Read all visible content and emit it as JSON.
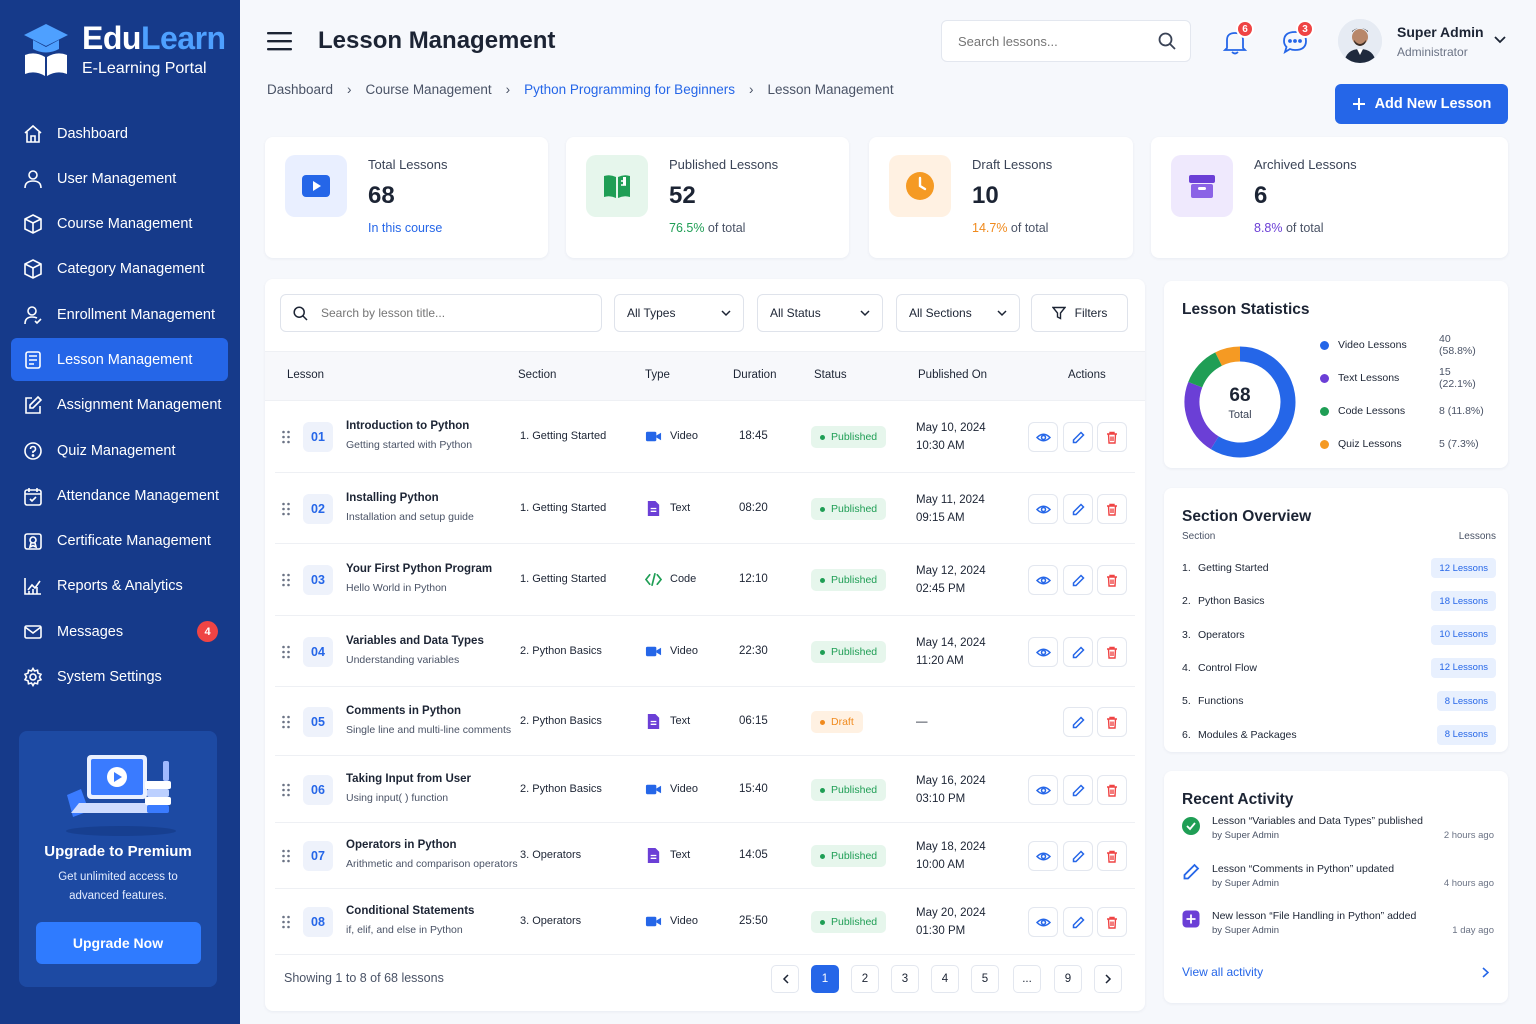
{
  "brand": {
    "name_part1": "Edu",
    "name_part2": "Learn",
    "subtitle": "E-Learning Portal"
  },
  "nav": [
    {
      "label": "Dashboard",
      "icon": "home-icon"
    },
    {
      "label": "User Management",
      "icon": "user-icon"
    },
    {
      "label": "Course Management",
      "icon": "cube-icon"
    },
    {
      "label": "Category Management",
      "icon": "cube-icon"
    },
    {
      "label": "Enrollment Management",
      "icon": "user-check-icon"
    },
    {
      "label": "Lesson Management",
      "icon": "document-icon",
      "active": true
    },
    {
      "label": "Assignment Management",
      "icon": "edit-icon"
    },
    {
      "label": "Quiz Management",
      "icon": "question-icon"
    },
    {
      "label": "Attendance Management",
      "icon": "calendar-icon"
    },
    {
      "label": "Certificate Management",
      "icon": "certificate-icon"
    },
    {
      "label": "Reports & Analytics",
      "icon": "chart-icon"
    },
    {
      "label": "Messages",
      "icon": "mail-icon",
      "badge": "4"
    },
    {
      "label": "System Settings",
      "icon": "gear-icon"
    }
  ],
  "promo": {
    "title": "Upgrade to Premium",
    "text_line1": "Get unlimited access to",
    "text_line2": "advanced features.",
    "button": "Upgrade Now"
  },
  "header": {
    "title": "Lesson Management",
    "search_placeholder": "Search lessons...",
    "notifications_count": "6",
    "messages_count": "3",
    "user_name": "Super Admin",
    "user_role": "Administrator"
  },
  "breadcrumb": [
    "Dashboard",
    "Course Management",
    "Python Programming for Beginners",
    "Lesson Management"
  ],
  "add_button": "Add New Lesson",
  "stats": [
    {
      "label": "Total Lessons",
      "value": "68",
      "foot_highlight": "In this course",
      "foot_rest": "",
      "color": "#2566e8"
    },
    {
      "label": "Published Lessons",
      "value": "52",
      "foot_highlight": "76.5%",
      "foot_rest": " of total",
      "color": "#1f9e55"
    },
    {
      "label": "Draft Lessons",
      "value": "10",
      "foot_highlight": "14.7%",
      "foot_rest": " of total",
      "color": "#f08a1d"
    },
    {
      "label": "Archived Lessons",
      "value": "6",
      "foot_highlight": "8.8%",
      "foot_rest": " of total",
      "color": "#6b3fd6"
    }
  ],
  "filters": {
    "search_placeholder": "Search by lesson title...",
    "type": "All Types",
    "status": "All Status",
    "section": "All Sections",
    "filters_label": "Filters"
  },
  "table": {
    "columns": [
      "Lesson",
      "Section",
      "Type",
      "Duration",
      "Status",
      "Published On",
      "Actions"
    ],
    "rows": [
      {
        "num": "01",
        "title": "Introduction to Python",
        "subtitle": "Getting started with Python",
        "section": "1. Getting Started",
        "type": "Video",
        "duration": "18:45",
        "status": "Published",
        "date": "May 10, 2024",
        "time": "10:30 AM"
      },
      {
        "num": "02",
        "title": "Installing Python",
        "subtitle": "Installation and setup guide",
        "section": "1. Getting Started",
        "type": "Text",
        "duration": "08:20",
        "status": "Published",
        "date": "May 11, 2024",
        "time": "09:15 AM"
      },
      {
        "num": "03",
        "title": "Your First Python Program",
        "subtitle": "Hello World in Python",
        "section": "1. Getting Started",
        "type": "Code",
        "duration": "12:10",
        "status": "Published",
        "date": "May 12, 2024",
        "time": "02:45 PM"
      },
      {
        "num": "04",
        "title": "Variables and Data Types",
        "subtitle": "Understanding variables",
        "section": "2. Python Basics",
        "type": "Video",
        "duration": "22:30",
        "status": "Published",
        "date": "May 14, 2024",
        "time": "11:20 AM"
      },
      {
        "num": "05",
        "title": "Comments in Python",
        "subtitle": "Single line and multi-line comments",
        "section": "2. Python Basics",
        "type": "Text",
        "duration": "06:15",
        "status": "Draft",
        "date": "—",
        "time": ""
      },
      {
        "num": "06",
        "title": "Taking Input from User",
        "subtitle": "Using input( ) function",
        "section": "2. Python Basics",
        "type": "Video",
        "duration": "15:40",
        "status": "Published",
        "date": "May 16, 2024",
        "time": "03:10 PM"
      },
      {
        "num": "07",
        "title": "Operators in Python",
        "subtitle": "Arithmetic and comparison operators",
        "section": "3. Operators",
        "type": "Text",
        "duration": "14:05",
        "status": "Published",
        "date": "May 18, 2024",
        "time": "10:00 AM"
      },
      {
        "num": "08",
        "title": "Conditional Statements",
        "subtitle": "if, elif, and else in Python",
        "section": "3. Operators",
        "type": "Video",
        "duration": "25:50",
        "status": "Published",
        "date": "May 20, 2024",
        "time": "01:30 PM"
      }
    ]
  },
  "pagination": {
    "showing": "Showing 1 to 8 of 68 lessons",
    "pages": [
      "1",
      "2",
      "3",
      "4",
      "5",
      "...",
      "9"
    ],
    "current": "1"
  },
  "lesson_stats": {
    "title": "Lesson Statistics",
    "total": "68",
    "total_label": "Total",
    "items": [
      {
        "label": "Video Lessons",
        "value": "40 (58.8%)",
        "count": 40,
        "color": "#2566e8"
      },
      {
        "label": "Text Lessons",
        "value": "15 (22.1%)",
        "count": 15,
        "color": "#6b3fd6"
      },
      {
        "label": "Code Lessons",
        "value": "8 (11.8%)",
        "count": 8,
        "color": "#1f9e55"
      },
      {
        "label": "Quiz Lessons",
        "value": "5 (7.3%)",
        "count": 5,
        "color": "#f59a23"
      }
    ]
  },
  "section_overview": {
    "title": "Section Overview",
    "col_section": "Section",
    "col_lessons": "Lessons",
    "rows": [
      {
        "num": "1.",
        "name": "Getting Started",
        "lessons": "12 Lessons"
      },
      {
        "num": "2.",
        "name": "Python Basics",
        "lessons": "18 Lessons"
      },
      {
        "num": "3.",
        "name": "Operators",
        "lessons": "10 Lessons"
      },
      {
        "num": "4.",
        "name": "Control Flow",
        "lessons": "12 Lessons"
      },
      {
        "num": "5.",
        "name": "Functions",
        "lessons": "8 Lessons"
      },
      {
        "num": "6.",
        "name": "Modules & Packages",
        "lessons": "8 Lessons"
      }
    ]
  },
  "recent_activity": {
    "title": "Recent Activity",
    "items": [
      {
        "text": "Lesson “Variables and Data Types” published",
        "by": "by Super Admin",
        "time": "2 hours ago",
        "icon": "check-circle-icon"
      },
      {
        "text": "Lesson “Comments in Python” updated",
        "by": "by Super Admin",
        "time": "4 hours ago",
        "icon": "pencil-icon"
      },
      {
        "text": "New lesson “File Handling in Python” added",
        "by": "by Super Admin",
        "time": "1 day ago",
        "icon": "plus-square-icon"
      }
    ],
    "view_all": "View all activity"
  }
}
